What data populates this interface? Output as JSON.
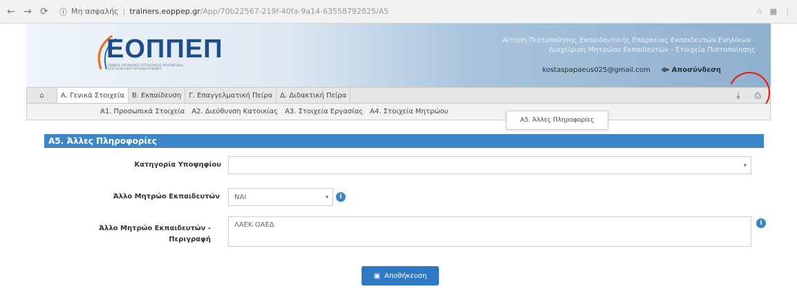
{
  "browser": {
    "secure_label": "Μη ασφαλής",
    "host": "trainers.eoppep.gr",
    "path": "/App/70b22567-219f-40fa-9a14-63558792825/A5"
  },
  "header": {
    "logo": "ΕΟΠΠΕΠ",
    "logo_sub": "ΕΘΝΙΚΟΣ ΟΡΓΑΝΙΣΜΟΣ ΠΙΣΤΟΠΟΙΗΣΗΣ ΠΡΟΣΟΝΤΩΝ & ΕΠΑΓΓΕΛΜΑΤΙΚΟΥ ΠΡΟΣΑΝΑΤΟΛΙΣΜΟΥ",
    "right_line1": "Αίτηση Πιστοποίησης Εκπαιδευτικής Επάρκειας Εκπαιδευτών Ενηλίκων -",
    "right_line2": "Διαχείριση Μητρώου Εκπαιδευτών - Στοιχεία Πιστοποίησης",
    "email": "kostaspapaeus025@gmail.com",
    "logout": "Αποσύνδεση"
  },
  "tabs": [
    {
      "label": "Α. Γενικά Στοιχεία"
    },
    {
      "label": "Β. Εκπαίδευση"
    },
    {
      "label": "Γ. Επαγγελματική Πείρα"
    },
    {
      "label": "Δ. Διδακτική Πείρα"
    }
  ],
  "subtabs": [
    {
      "label": "Α1. Προσωπικά Στοιχεία"
    },
    {
      "label": "Α2. Διεύθυνση Κατοικίας"
    },
    {
      "label": "Α3. Στοιχεία Εργασίας"
    },
    {
      "label": "Α4. Στοιχεία Μητρώου"
    }
  ],
  "active_subtab": "Α5. Άλλες Πληροφορίες",
  "section_title": "Α5. Άλλες Πληροφορίες",
  "form": {
    "category_label": "Κατηγορία Υποψηφίου",
    "category_value": "",
    "registry_label": "Άλλο Μητρώο Εκπαιδευτών",
    "registry_value": "ΝΑΙ",
    "description_label_1": "Άλλο Μητρώο Εκπαιδευτών -",
    "description_label_2": "Περιγραφή",
    "description_value": "ΛΑΕΚ ΟΑΕΔ"
  },
  "save_label": "Αποθήκευση"
}
